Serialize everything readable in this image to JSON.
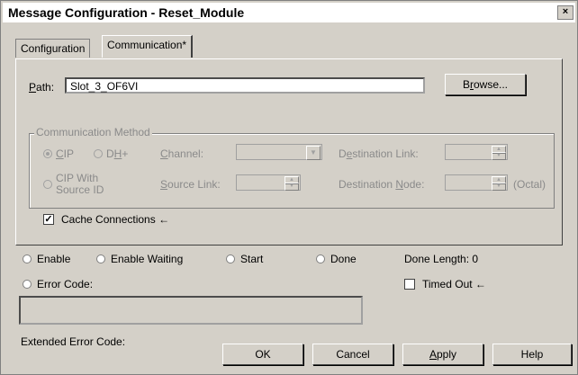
{
  "window": {
    "title": "Message Configuration - Reset_Module",
    "close": "×"
  },
  "tabs": [
    {
      "label": "Configuration"
    },
    {
      "label": "Communication*"
    }
  ],
  "path": {
    "label_pre": "",
    "label_ul": "P",
    "label_post": "ath:",
    "value": "Slot_3_OF6VI",
    "browse_pre": "B",
    "browse_ul": "r",
    "browse_post": "owse..."
  },
  "comm_method": {
    "legend": "Communication Method",
    "cip_ul": "C",
    "cip_post": "IP",
    "dh_pre": "D",
    "dh_ul": "H",
    "dh_post": "+",
    "channel_ul": "C",
    "channel_post": "hannel:",
    "dest_link_pre": "D",
    "dest_link_ul": "e",
    "dest_link_post": "stination Link:",
    "cip_with": "CIP With",
    "cip_with_ul": "W",
    "source_id": "Source ID",
    "source_link_ul": "S",
    "source_link_post": "ource Link:",
    "dest_node_pre": "Destination ",
    "dest_node_ul": "N",
    "dest_node_post": "ode:",
    "octal": "(Octal)"
  },
  "cache": {
    "label": "Cache Connections",
    "arrow": "←",
    "checked": true
  },
  "status": {
    "enable": "Enable",
    "enable_waiting": "Enable Waiting",
    "start": "Start",
    "done": "Done",
    "done_length": "Done Length: 0",
    "error_code": "Error Code:",
    "timed_out": "Timed Out",
    "timed_out_arrow": "←",
    "extended_error": "Extended Error Code:"
  },
  "buttons": {
    "ok": "OK",
    "cancel": "Cancel",
    "apply_ul": "A",
    "apply_post": "pply",
    "help": "Help"
  }
}
